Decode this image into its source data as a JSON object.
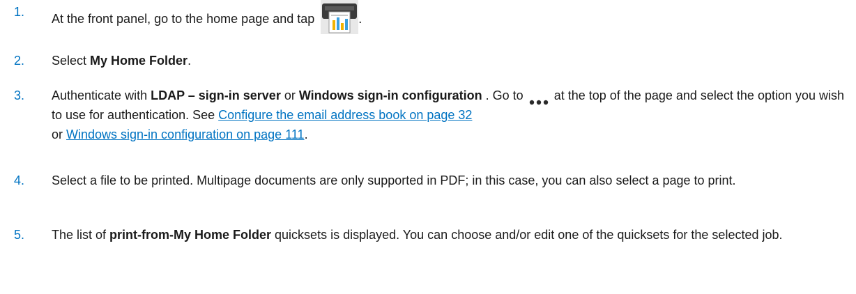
{
  "steps": [
    {
      "num": "1.",
      "parts": {
        "t1": "At the front panel, go to the home page and tap",
        "t2": "."
      }
    },
    {
      "num": "2.",
      "parts": {
        "t1": "Select ",
        "b1": "My Home Folder",
        "t2": "."
      }
    },
    {
      "num": "3.",
      "parts": {
        "t1": "Authenticate with ",
        "b1": "LDAP – sign-in server",
        "t2": " or ",
        "b2": "Windows sign-in configuration",
        "t3": " . Go to",
        "t4": "at the top of the page and select the option you wish to use for authentication. See ",
        "l1": "Configure the email address book on page 32",
        "t5": "or ",
        "l2": "Windows sign-in configuration on page 111",
        "t6": "."
      }
    },
    {
      "num": "4.",
      "parts": {
        "t1": "Select a file to be printed. Multipage documents are only supported in PDF; in this case, you can also select a page to print."
      }
    },
    {
      "num": "5.",
      "parts": {
        "t1": "The list of ",
        "b1": "print-from-My Home Folder",
        "t2": " quicksets is displayed. You can choose and/or edit one of the quicksets for the selected job."
      }
    }
  ],
  "icons": {
    "printer": "printer-home-folder-icon",
    "more": "more-options-dots-icon"
  },
  "colors": {
    "step_number": "#0073c2",
    "link": "#0073c2"
  }
}
